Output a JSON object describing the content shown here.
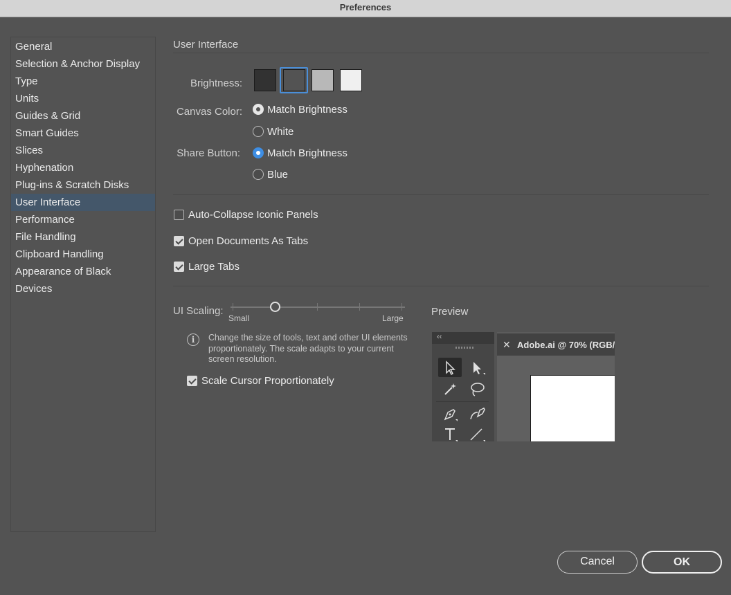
{
  "window": {
    "title": "Preferences"
  },
  "sidebar": {
    "items": [
      {
        "label": "General",
        "selected": false
      },
      {
        "label": "Selection & Anchor Display",
        "selected": false
      },
      {
        "label": "Type",
        "selected": false
      },
      {
        "label": "Units",
        "selected": false
      },
      {
        "label": "Guides & Grid",
        "selected": false
      },
      {
        "label": "Smart Guides",
        "selected": false
      },
      {
        "label": "Slices",
        "selected": false
      },
      {
        "label": "Hyphenation",
        "selected": false
      },
      {
        "label": "Plug-ins & Scratch Disks",
        "selected": false
      },
      {
        "label": "User Interface",
        "selected": true
      },
      {
        "label": "Performance",
        "selected": false
      },
      {
        "label": "File Handling",
        "selected": false
      },
      {
        "label": "Clipboard Handling",
        "selected": false
      },
      {
        "label": "Appearance of Black",
        "selected": false
      },
      {
        "label": "Devices",
        "selected": false
      }
    ]
  },
  "main": {
    "section_title": "User Interface",
    "brightness": {
      "label": "Brightness:",
      "swatches": [
        "#323232",
        "#535353",
        "#b8b8b8",
        "#f0f0f0"
      ],
      "selected_index": 1,
      "selection_color": "#4a8fd9"
    },
    "canvas_color": {
      "label": "Canvas Color:",
      "options": [
        "Match Brightness",
        "White"
      ],
      "selected": "Match Brightness"
    },
    "share_button": {
      "label": "Share Button:",
      "options": [
        "Match Brightness",
        "Blue"
      ],
      "selected": "Match Brightness",
      "accent": "#3e8ee4"
    },
    "checkboxes": {
      "auto_collapse": {
        "label": "Auto-Collapse Iconic Panels",
        "checked": false
      },
      "open_docs_tabs": {
        "label": "Open Documents As Tabs",
        "checked": true
      },
      "large_tabs": {
        "label": "Large Tabs",
        "checked": true
      }
    },
    "ui_scaling": {
      "label": "UI Scaling:",
      "min_label": "Small",
      "max_label": "Large",
      "steps": 5,
      "value_step": 1,
      "info_icon": "info-icon",
      "info_text": "Change the size of tools, text and other UI elements proportionately. The scale adapts to your current screen resolution.",
      "scale_cursor": {
        "label": "Scale Cursor Proportionately",
        "checked": true
      }
    },
    "preview": {
      "label": "Preview",
      "panel_collapse": "‹‹",
      "doc_tab_close": "✕",
      "doc_tab_title": "Adobe.ai @ 70% (RGB/",
      "tools": [
        "selection-tool",
        "direct-selection-tool",
        "magic-wand-tool",
        "lasso-tool",
        "pen-tool",
        "curvature-tool",
        "type-tool",
        "line-segment-tool"
      ]
    }
  },
  "footer": {
    "cancel_label": "Cancel",
    "ok_label": "OK"
  }
}
